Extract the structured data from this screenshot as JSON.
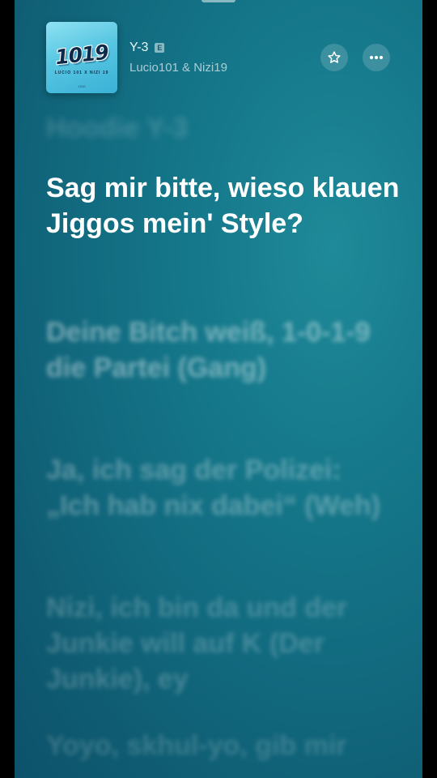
{
  "now_playing": {
    "title": "Y-3",
    "explicit_badge": "E",
    "artist": "Lucio101 & Nizi19",
    "artwork": {
      "logo_text": "1019",
      "subtitle": "LUCIO 101 X NIZI 19",
      "mark": "1019"
    }
  },
  "actions": {
    "favorite_icon": "star-icon",
    "more_icon": "ellipsis-icon"
  },
  "lyrics": {
    "previous": "Hoodie Y-3",
    "current": "Sag mir bitte, wieso klauen Jiggos mein' Style?",
    "upcoming": [
      "Deine Bitch weiß, 1-0-1-9 die Partei (Gang)",
      "Ja, ich sag der Polizei: „Ich hab nix dabei“ (Weh)",
      "Nizi, ich bin da und der Junkie will auf K (Der Junkie), ey",
      "Yoyo, skhul-yo, gib mir"
    ]
  },
  "colors": {
    "background": "#126b80",
    "current_lyric": "#ffffff"
  }
}
